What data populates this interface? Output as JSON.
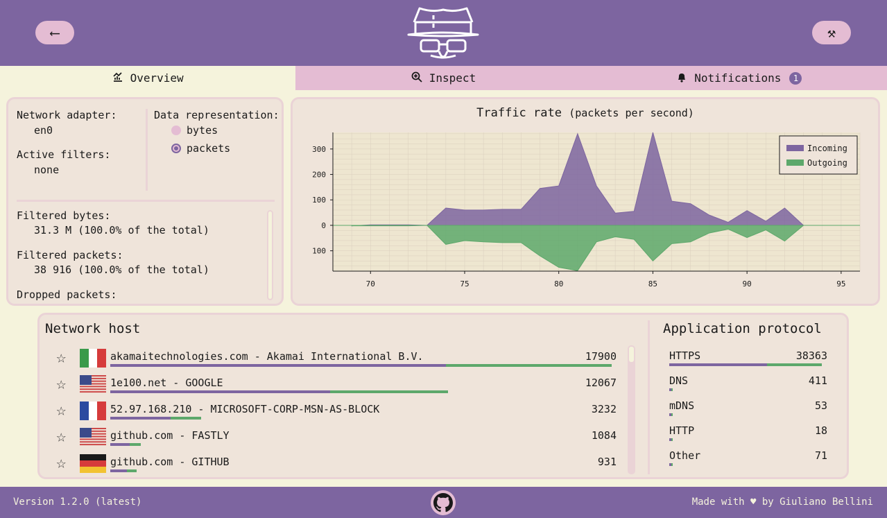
{
  "header": {
    "back_icon": "arrow-left-icon",
    "settings_icon": "wrench-screwdriver-icon",
    "logo": "sniffnet-hat-glasses-logo",
    "back_glyph": "⟵",
    "settings_glyph": "⚒"
  },
  "tabs": [
    {
      "label": "Overview",
      "icon": "chart-icon",
      "glyph": "📈",
      "active": true
    },
    {
      "label": "Inspect",
      "icon": "magnifier-icon",
      "glyph": "⊕",
      "active": false
    },
    {
      "label": "Notifications",
      "icon": "bell-icon",
      "glyph": "🔔",
      "active": false,
      "badge": "1"
    }
  ],
  "info": {
    "adapter_label": "Network adapter:",
    "adapter_value": "en0",
    "filters_label": "Active filters:",
    "filters_value": "none",
    "repr_label": "Data representation:",
    "repr_options": [
      "bytes",
      "packets"
    ],
    "repr_selected": "packets",
    "filtered_bytes_label": "Filtered bytes:",
    "filtered_bytes_value": "31.3 M (100.0% of the total)",
    "filtered_packets_label": "Filtered packets:",
    "filtered_packets_value": "38 916 (100.0% of the total)",
    "dropped_label": "Dropped packets:"
  },
  "chart_data": {
    "type": "area",
    "title": "Traffic rate",
    "subtitle": "(packets per second)",
    "x": [
      69,
      70,
      71,
      72,
      73,
      74,
      75,
      76,
      77,
      78,
      79,
      80,
      81,
      82,
      83,
      84,
      85,
      86,
      87,
      88,
      89,
      90,
      91,
      92,
      93
    ],
    "series": [
      {
        "name": "Incoming",
        "color": "#7d65a0",
        "values": [
          -2,
          2,
          2,
          2,
          0,
          68,
          60,
          60,
          63,
          63,
          145,
          155,
          360,
          155,
          48,
          55,
          365,
          95,
          85,
          40,
          12,
          58,
          16,
          68,
          0
        ]
      },
      {
        "name": "Outgoing",
        "color": "#5da86b",
        "values": [
          -2,
          -2,
          -2,
          -2,
          0,
          -75,
          -60,
          -65,
          -68,
          -68,
          -120,
          -165,
          -178,
          -65,
          -45,
          -55,
          -140,
          -72,
          -65,
          -30,
          -15,
          -48,
          -18,
          -62,
          0
        ]
      }
    ],
    "xlim": [
      68,
      96
    ],
    "ylim": [
      -180,
      365
    ],
    "xticks": [
      70,
      75,
      80,
      85,
      90,
      95
    ],
    "yticks": [
      {
        "v": 300,
        "label": "300"
      },
      {
        "v": 200,
        "label": "200"
      },
      {
        "v": 100,
        "label": "100"
      },
      {
        "v": 0,
        "label": "0"
      },
      {
        "v": -100,
        "label": "100"
      }
    ],
    "grid": true,
    "legend": "top-right"
  },
  "hosts": {
    "title": "Network host",
    "items": [
      {
        "name": "akamaitechnologies.com - Akamai International B.V.",
        "value": "17900",
        "flag": "it",
        "in": 0.67,
        "out": 0.33
      },
      {
        "name": "1e100.net - GOOGLE",
        "value": "12067",
        "flag": "us",
        "in": 0.65,
        "out": 0.35
      },
      {
        "name": "52.97.168.210 - MICROSOFT-CORP-MSN-AS-BLOCK",
        "value": "3232",
        "flag": "fr",
        "in": 0.67,
        "out": 0.33
      },
      {
        "name": "github.com - FASTLY",
        "value": "1084",
        "flag": "us",
        "in": 0.64,
        "out": 0.36
      },
      {
        "name": "github.com - GITHUB",
        "value": "931",
        "flag": "de",
        "in": 0.63,
        "out": 0.37
      }
    ]
  },
  "protocols": {
    "title": "Application protocol",
    "items": [
      {
        "name": "HTTPS",
        "value": "38363",
        "in": 0.64,
        "out": 0.36
      },
      {
        "name": "DNS",
        "value": "411",
        "in": 0.5,
        "out": 0.5
      },
      {
        "name": "mDNS",
        "value": "53",
        "in": 0.5,
        "out": 0.5
      },
      {
        "name": "HTTP",
        "value": "18",
        "in": 0.5,
        "out": 0.5
      },
      {
        "name": "Other",
        "value": "71",
        "in": 0.5,
        "out": 0.5
      }
    ]
  },
  "footer": {
    "version": "Version 1.2.0 (latest)",
    "made_with": "Made with ♥ by Giuliano Bellini",
    "github_icon": "github-icon"
  }
}
